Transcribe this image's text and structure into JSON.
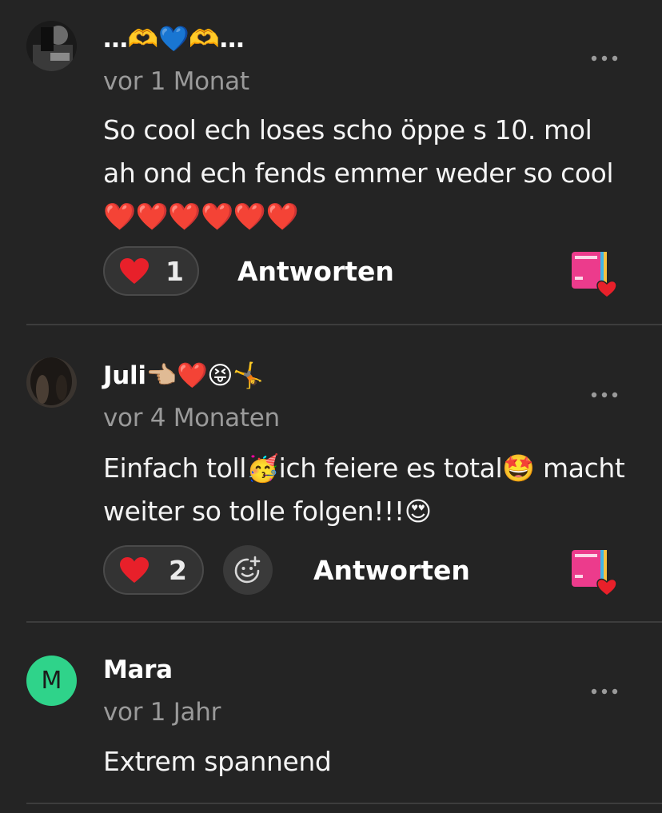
{
  "comments": [
    {
      "author": "…🫶💙🫶…",
      "time": "vor 1 Monat",
      "text": "So cool ech loses scho öppe s 10. mol ah ond ech fends emmer weder so cool❤️❤️❤️❤️❤️❤️",
      "likes": "1",
      "reply_label": "Antworten",
      "avatar_icon": "photo-avatar",
      "has_react_button": false
    },
    {
      "author": "Juli👈🏼❤️😝🤸",
      "time": "vor 4 Monaten",
      "text": "Einfach toll🥳ich feiere es total🤩 macht weiter so tolle folgen!!!😍",
      "likes": "2",
      "reply_label": "Antworten",
      "avatar_icon": "photo-avatar",
      "has_react_button": true
    },
    {
      "author": "Mara",
      "time": "vor 1 Jahr",
      "text": "Extrem spannend",
      "avatar_letter": "M",
      "avatar_color": "#2fd38a"
    }
  ],
  "colors": {
    "background": "#242424",
    "muted_text": "#9a9a9a",
    "heart": "#e8202a",
    "divider": "#3d3d3d"
  },
  "icons": {
    "more": "more-dots-icon",
    "heart": "heart-icon",
    "add_reaction": "add-reaction-icon",
    "creator_like": "creator-liked-badge-icon"
  }
}
